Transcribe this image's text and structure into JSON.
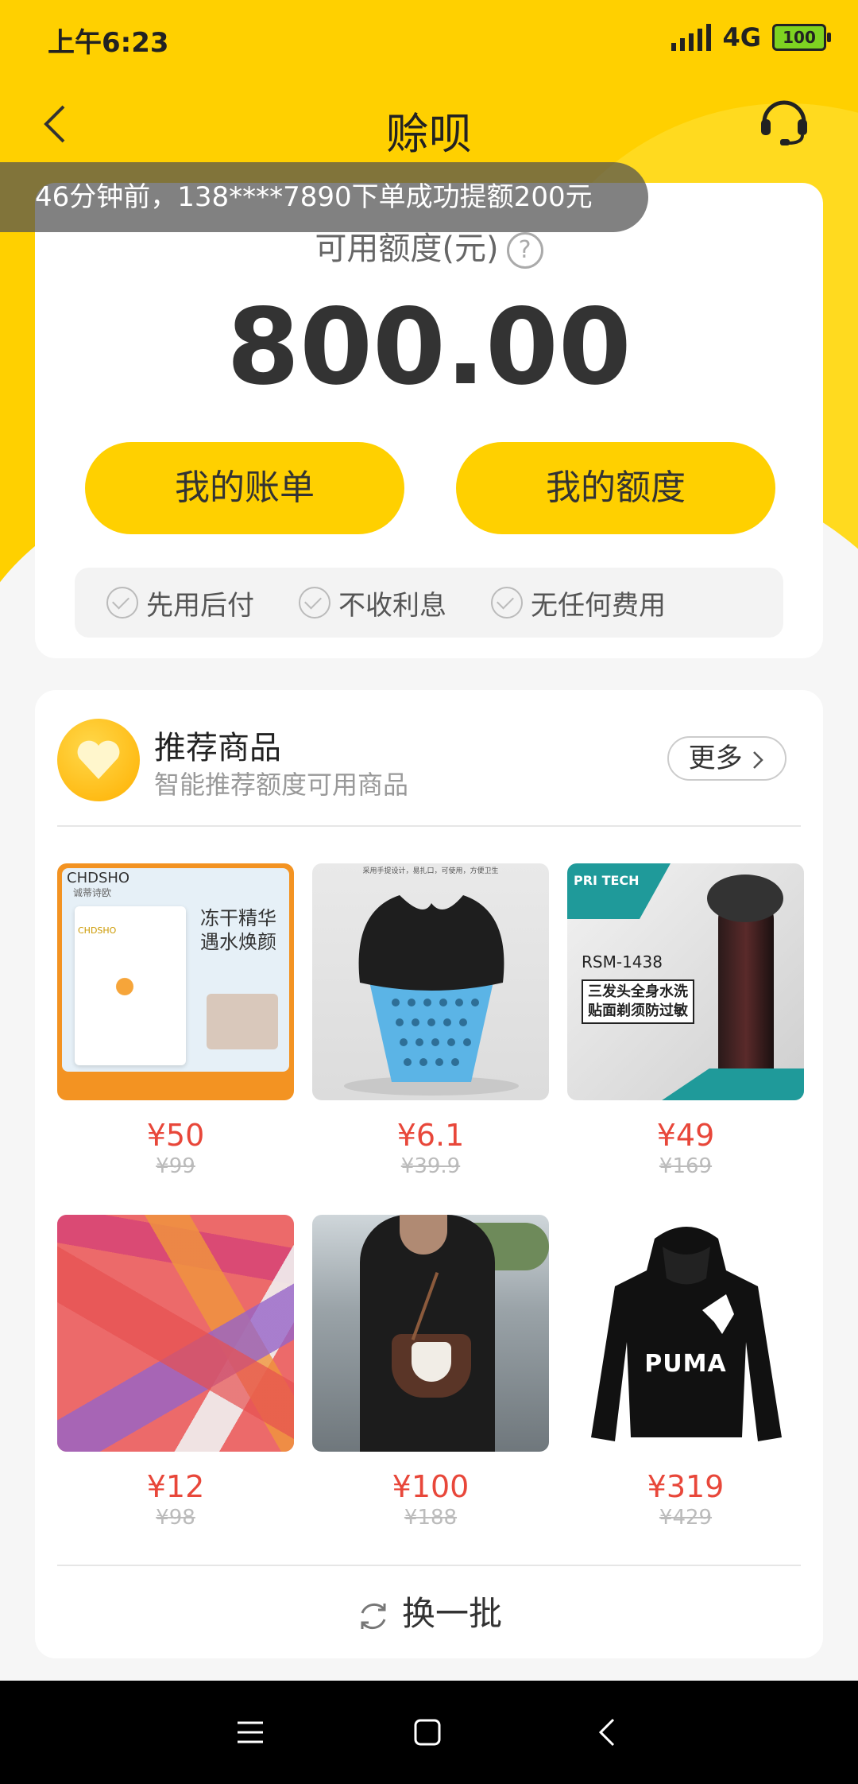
{
  "status_bar": {
    "time": "上午6:23",
    "network": "4G",
    "battery": "100"
  },
  "nav": {
    "title": "赊呗"
  },
  "notice": {
    "text": "46分钟前，138****7890下单成功提额200元"
  },
  "credit": {
    "label": "可用额度(元)",
    "amount": "800.00",
    "bill_button": "我的账单",
    "limit_button": "我的额度",
    "features": [
      "先用后付",
      "不收利息",
      "无任何费用"
    ]
  },
  "recommend": {
    "title": "推荐商品",
    "subtitle": "智能推荐额度可用商品",
    "more_label": "更多",
    "products": [
      {
        "price": "¥50",
        "original_price": "¥99",
        "image_text": [
          "CHDSHO",
          "诚蒂诗欧",
          "冻干精华",
          "遇水焕颜",
          "CHDSHO"
        ]
      },
      {
        "price": "¥6.1",
        "original_price": "¥39.9",
        "image_text": [
          "采用手提设计，易扎口，可使用，方便卫生"
        ]
      },
      {
        "price": "¥49",
        "original_price": "¥169",
        "image_text": [
          "PRI TECH",
          "RSM-1438",
          "三发头全身水洗",
          "贴面剃须防过敏"
        ]
      },
      {
        "price": "¥12",
        "original_price": "¥98",
        "image_text": []
      },
      {
        "price": "¥100",
        "original_price": "¥188",
        "image_text": []
      },
      {
        "price": "¥319",
        "original_price": "¥429",
        "image_text": [
          "PUMA"
        ]
      }
    ],
    "refresh_label": "换一批"
  },
  "colors": {
    "accent": "#ffd000",
    "price": "#e8473a"
  }
}
